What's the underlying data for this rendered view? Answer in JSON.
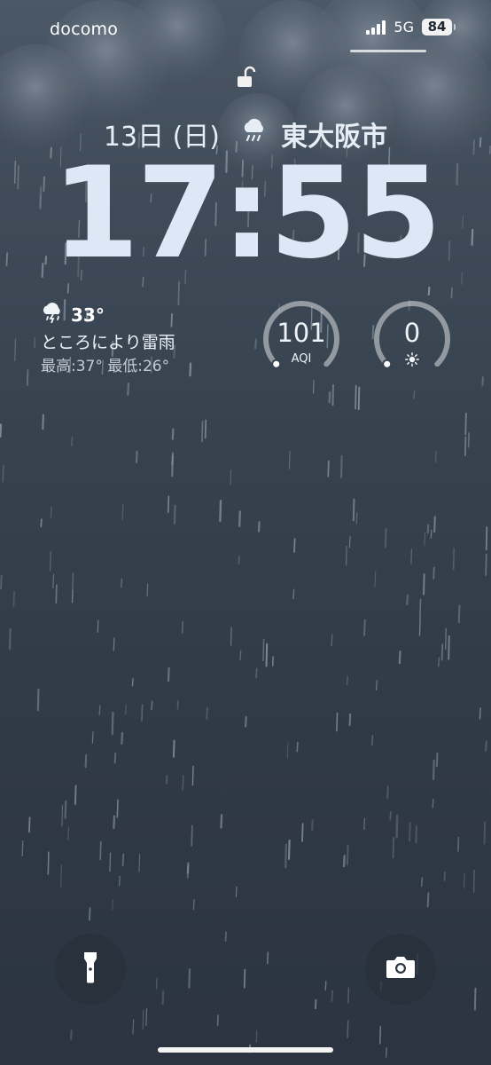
{
  "status_bar": {
    "carrier": "docomo",
    "network": "5G",
    "battery": "84"
  },
  "lock_screen": {
    "date": "13日 (日)",
    "location": "東大阪市",
    "location_icon": "cloud-rain-icon",
    "time": "17:55"
  },
  "widgets": {
    "weather": {
      "icon": "cloud-thunder-icon",
      "temperature": "33°",
      "condition": "ところにより雷雨",
      "range": "最高:37° 最低:26°"
    },
    "aqi": {
      "value": "101",
      "label": "AQI",
      "level": 0.45
    },
    "uv": {
      "value": "0",
      "icon": "sun-icon",
      "level": 0.0
    }
  },
  "controls": {
    "left": "flashlight-icon",
    "right": "camera-icon"
  },
  "colors": {
    "background_top": "#4b5866",
    "background_bottom": "#2b3440",
    "time": "#dce8f5"
  }
}
